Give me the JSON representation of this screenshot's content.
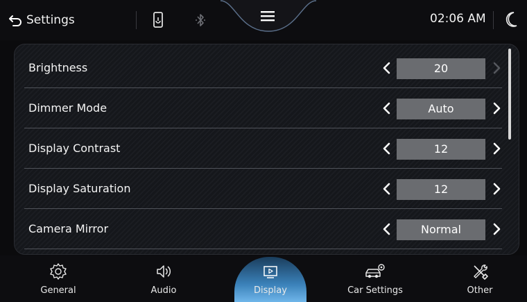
{
  "header": {
    "title": "Settings",
    "time": "02:06 AM"
  },
  "settings": [
    {
      "label": "Brightness",
      "value": "20"
    },
    {
      "label": "Dimmer Mode",
      "value": "Auto"
    },
    {
      "label": "Display Contrast",
      "value": "12"
    },
    {
      "label": "Display Saturation",
      "value": "12"
    },
    {
      "label": "Camera Mirror",
      "value": "Normal"
    }
  ],
  "nav": [
    {
      "label": "General",
      "icon": "gear-icon"
    },
    {
      "label": "Audio",
      "icon": "speaker-icon"
    },
    {
      "label": "Display",
      "icon": "display-icon",
      "active": true
    },
    {
      "label": "Car Settings",
      "icon": "car-gear-icon"
    },
    {
      "label": "Other",
      "icon": "tools-icon"
    }
  ],
  "colors": {
    "active_tab": "#3a80b8",
    "value_box": "#6a6c70",
    "background": "#0b0b0d"
  }
}
